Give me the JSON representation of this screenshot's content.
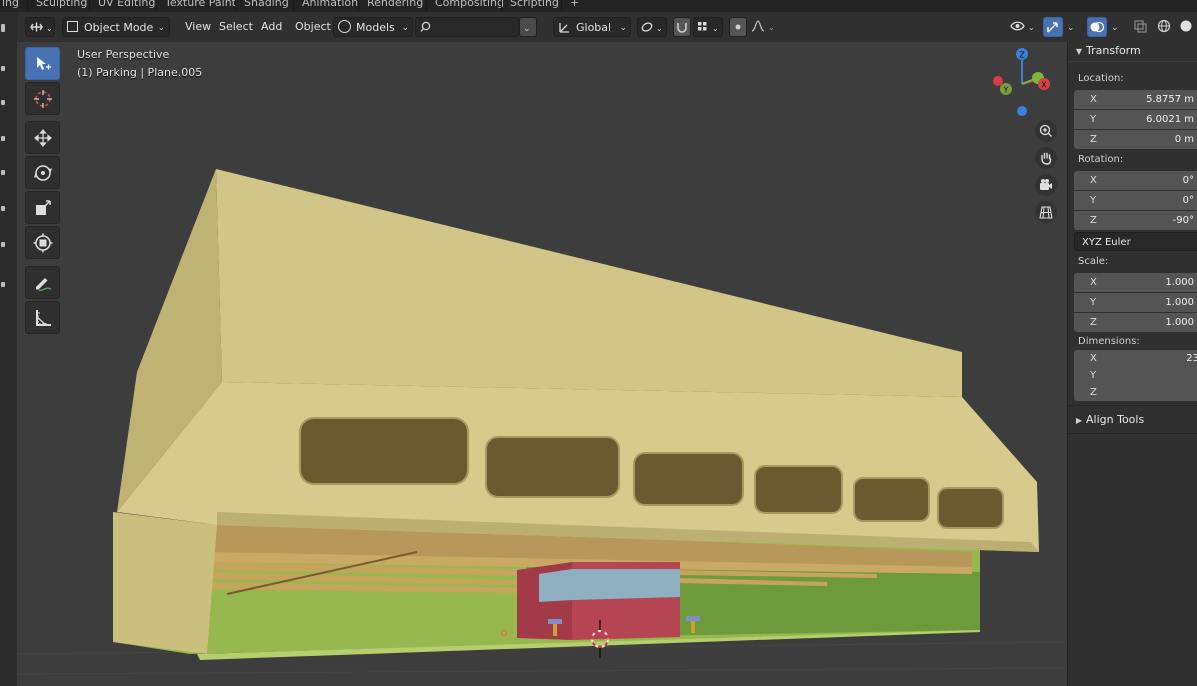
{
  "workspace_tabs": [
    "ing",
    "Sculpting",
    "UV Editing",
    "Texture Paint",
    "Shading",
    "Animation",
    "Rendering",
    "Compositing",
    "Scripting",
    "+"
  ],
  "header": {
    "mode": "Object Mode",
    "menus": [
      "View",
      "Select",
      "Add",
      "Object"
    ],
    "collection": "Models",
    "search_placeholder": "",
    "orientation": "Global"
  },
  "viewport": {
    "perspective": "User Perspective",
    "object_info": "(1) Parking  | Plane.005",
    "gizmo": {
      "z": "Z",
      "y": "Y",
      "x": "X"
    }
  },
  "panel": {
    "transform_title": "Transform",
    "location_label": "Location:",
    "location": [
      {
        "axis": "X",
        "value": "5.8757 m"
      },
      {
        "axis": "Y",
        "value": "6.0021 m"
      },
      {
        "axis": "Z",
        "value": "0 m"
      }
    ],
    "rotation_label": "Rotation:",
    "rotation": [
      {
        "axis": "X",
        "value": "0°"
      },
      {
        "axis": "Y",
        "value": "0°"
      },
      {
        "axis": "Z",
        "value": "-90°"
      }
    ],
    "rotation_mode": "XYZ Euler",
    "scale_label": "Scale:",
    "scale": [
      {
        "axis": "X",
        "value": "1.000"
      },
      {
        "axis": "Y",
        "value": "1.000"
      },
      {
        "axis": "Z",
        "value": "1.000"
      }
    ],
    "dimensions_label": "Dimensions:",
    "dimensions": [
      {
        "axis": "X",
        "value": "23"
      },
      {
        "axis": "Y",
        "value": ""
      },
      {
        "axis": "Z",
        "value": ""
      }
    ],
    "align_title": "Align Tools"
  },
  "colors": {
    "accent": "#4772b3",
    "building_top": "#d4c98a",
    "building_wall": "#c8bd7c",
    "ground": "#97b84f",
    "red_box": "#a33a48",
    "glass": "#8fb0c0",
    "wood": "#c7a45c"
  }
}
